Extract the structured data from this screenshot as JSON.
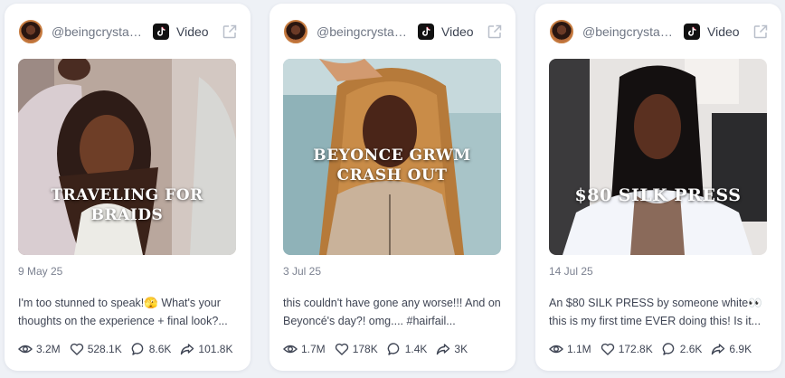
{
  "cards": [
    {
      "handle": "@beingcrystal...",
      "type_label": "Video",
      "overlay_text": "TRAVELING FOR BRAIDS",
      "date": "9 May 25",
      "caption": "I'm too stunned to speak!🫣 What's your thoughts on the experience + final look?...",
      "stats": {
        "views": "3.2M",
        "likes": "528.1K",
        "comments": "8.6K",
        "shares": "101.8K"
      }
    },
    {
      "handle": "@beingcrystal...",
      "type_label": "Video",
      "overlay_text": "BEYONCE GRWM CRASH OUT",
      "date": "3 Jul 25",
      "caption": "this couldn't have gone any worse!!! And on Beyoncé's day?! omg.... #hairfail...",
      "stats": {
        "views": "1.7M",
        "likes": "178K",
        "comments": "1.4K",
        "shares": "3K"
      }
    },
    {
      "handle": "@beingcrystal...",
      "type_label": "Video",
      "overlay_text": "$80 SILK PRESS",
      "date": "14 Jul 25",
      "caption": "An $80 SILK PRESS by someone white👀 this is my first time EVER doing this! Is it...",
      "stats": {
        "views": "1.1M",
        "likes": "172.8K",
        "comments": "2.6K",
        "shares": "6.9K"
      }
    }
  ],
  "icons": {
    "platform": "tiktok-icon",
    "external": "external-link-icon",
    "views": "eye-icon",
    "likes": "heart-icon",
    "comments": "comment-icon",
    "shares": "share-icon"
  },
  "colors": {
    "page_bg": "#eef1f6",
    "card_bg": "#ffffff",
    "muted_text": "#7b8190",
    "body_text": "#3f4554"
  }
}
